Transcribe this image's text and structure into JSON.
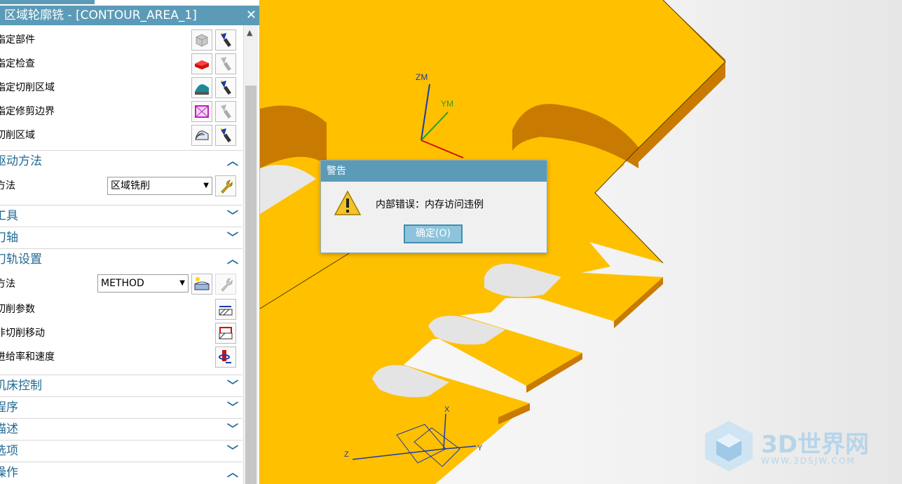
{
  "window": {
    "title": "区域轮廓铣 - [CONTOUR_AREA_1]",
    "close": "✕"
  },
  "geometry_rows": [
    {
      "label": "指定部件",
      "icon1": "part-cube-icon",
      "icon2": "flashlight-icon"
    },
    {
      "label": "指定检查",
      "icon1": "check-body-icon",
      "icon2": "flashlight-icon"
    },
    {
      "label": "指定切削区域",
      "icon1": "cut-area-icon",
      "icon2": "flashlight-icon"
    },
    {
      "label": "指定修剪边界",
      "icon1": "trim-boundary-icon",
      "icon2": "flashlight-icon"
    },
    {
      "label": "切削区域",
      "icon1": "cut-region-icon",
      "icon2": "flashlight-icon"
    }
  ],
  "drive_method": {
    "header": "驱动方法",
    "method_label": "方法",
    "method_value": "区域铣削"
  },
  "collapsed_1": [
    {
      "label": "工具"
    },
    {
      "label": "刀轴"
    }
  ],
  "path_settings": {
    "header": "刀轨设置",
    "method_label": "方法",
    "method_value": "METHOD",
    "rows": [
      {
        "label": "切削参数"
      },
      {
        "label": "非切削移动"
      },
      {
        "label": "进给率和速度"
      }
    ]
  },
  "collapsed_2": [
    {
      "label": "机床控制"
    },
    {
      "label": "程序"
    },
    {
      "label": "描述"
    },
    {
      "label": "选项"
    }
  ],
  "operation": {
    "header": "操作"
  },
  "dialog": {
    "title": "警告",
    "message": "内部错误：内存访问违例",
    "ok_label": "确定(O)"
  },
  "axes": {
    "zm": "ZM",
    "ym": "YM",
    "x": "X",
    "y": "Y",
    "z": "Z"
  },
  "watermark": {
    "brand": "3D世界网",
    "url": "WWW.3DSJW.COM"
  },
  "colors": {
    "accent": "#5b9bb8",
    "part_top": "#ffc000",
    "part_side": "#c97a00",
    "section_text": "#1f6b94"
  }
}
